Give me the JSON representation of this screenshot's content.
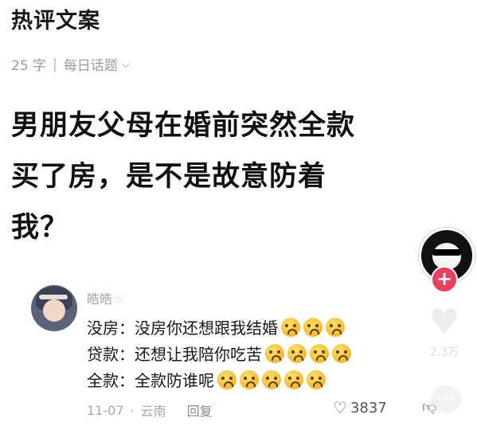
{
  "header": {
    "title": "热评文案"
  },
  "meta": {
    "count": "25 字",
    "separator": "|",
    "topic": "每日话题",
    "chevron": "⌵"
  },
  "post": {
    "lines": [
      "男朋友父母在婚前突然全款",
      "买了房，是不是故意防着",
      "我？"
    ]
  },
  "author": {
    "follow_symbol": "+"
  },
  "sidebar": {
    "like_count_ghost": "2.3万"
  },
  "comment": {
    "username": "皓皓",
    "username_badge": "♡",
    "lines": [
      {
        "label": "没房：",
        "text": "没房你还想跟我结婚",
        "emoji_count": 3
      },
      {
        "label": "贷款：",
        "text": "还想让我陪你吃苦",
        "emoji_count": 4
      },
      {
        "label": "全款：",
        "text": "全款防谁呢",
        "emoji_count": 5
      }
    ],
    "date": "11-07",
    "location": "云南",
    "reply_label": "回复",
    "likes": "3837"
  },
  "icons": {
    "like": "heart-outline-icon",
    "dislike": "thumb-down-icon",
    "follow": "plus-icon",
    "chevron": "chevron-down-icon"
  },
  "colors": {
    "follow_button": "#ef3e5b",
    "emoji": "#f6b92b"
  }
}
